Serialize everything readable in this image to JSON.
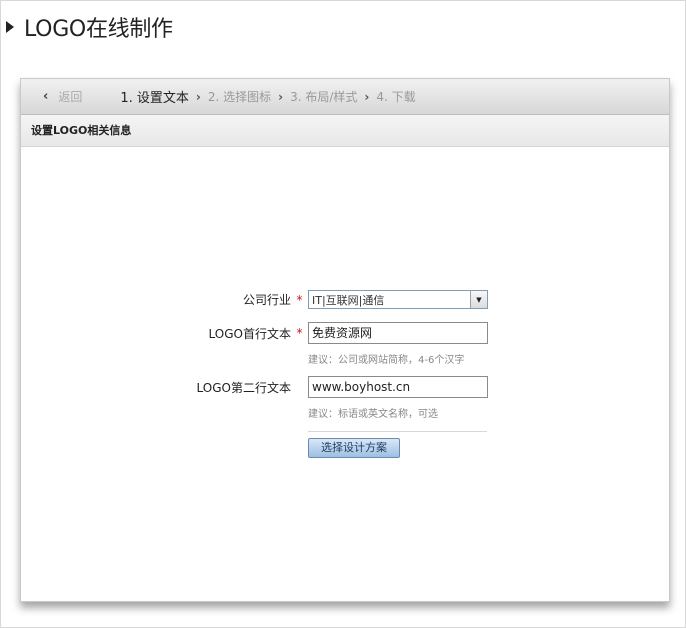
{
  "page": {
    "title": "LOGO在线制作"
  },
  "steps": {
    "back_label": "返回",
    "items": [
      {
        "label": "1. 设置文本",
        "active": true
      },
      {
        "label": "2. 选择图标",
        "active": false
      },
      {
        "label": "3. 布局/样式",
        "active": false
      },
      {
        "label": "4. 下载",
        "active": false
      }
    ]
  },
  "section": {
    "title": "设置LOGO相关信息"
  },
  "form": {
    "industry": {
      "label": "公司行业",
      "required_mark": "*",
      "value": "IT|互联网|通信"
    },
    "line1": {
      "label": "LOGO首行文本",
      "required_mark": "*",
      "value": "免费资源网",
      "hint": "建议：公司或网站简称，4-6个汉字"
    },
    "line2": {
      "label": "LOGO第二行文本",
      "value": "www.boyhost.cn",
      "hint": "建议：标语或英文名称，可选"
    },
    "submit_label": "选择设计方案"
  },
  "colors": {
    "required": "#cc1111",
    "button": "#9ebfe2"
  }
}
